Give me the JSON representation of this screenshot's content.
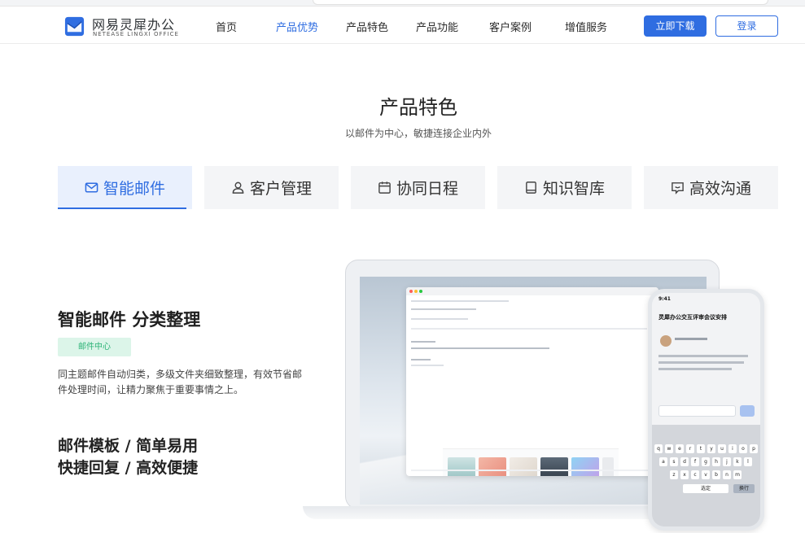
{
  "brand": {
    "name_cn": "网易灵犀办公",
    "name_en": "NETEASE LINGXI OFFICE"
  },
  "nav": {
    "items": [
      {
        "label": "首页"
      },
      {
        "label": "产品优势"
      },
      {
        "label": "产品特色"
      },
      {
        "label": "产品功能"
      },
      {
        "label": "客户案例"
      },
      {
        "label": "增值服务"
      }
    ],
    "active": "产品优势",
    "download": "立即下载",
    "login": "登录"
  },
  "section": {
    "title": "产品特色",
    "subtitle": "以邮件为中心，敏捷连接企业内外"
  },
  "tabs": [
    {
      "label": "智能邮件",
      "icon": "mail-icon"
    },
    {
      "label": "客户管理",
      "icon": "user-icon"
    },
    {
      "label": "协同日程",
      "icon": "calendar-icon"
    },
    {
      "label": "知识智库",
      "icon": "book-icon"
    },
    {
      "label": "高效沟通",
      "icon": "chat-icon"
    }
  ],
  "feature": {
    "title": "智能邮件 分类整理",
    "badge": "邮件中心",
    "description": "同主题邮件自动归类，多级文件夹细致整理，有效节省邮件处理时间，让精力聚焦于重要事情之上。",
    "more": [
      "邮件模板 / 简单易用",
      "快捷回复 / 高效便捷"
    ]
  },
  "phone": {
    "time": "9:41",
    "subject": "灵犀办公交互评审会议安排",
    "keyboard_row1": [
      "q",
      "w",
      "e",
      "r",
      "t",
      "y",
      "u",
      "i",
      "o",
      "p"
    ],
    "keyboard_row2": [
      "a",
      "s",
      "d",
      "f",
      "g",
      "h",
      "j",
      "k",
      "l"
    ],
    "keyboard_row3": [
      "z",
      "x",
      "c",
      "v",
      "b",
      "n",
      "m"
    ],
    "confirm": "选定",
    "newline": "换行"
  },
  "colors": {
    "accent": "#2f6de1",
    "badge_bg": "#dcf5e9",
    "badge_text": "#2db377"
  }
}
